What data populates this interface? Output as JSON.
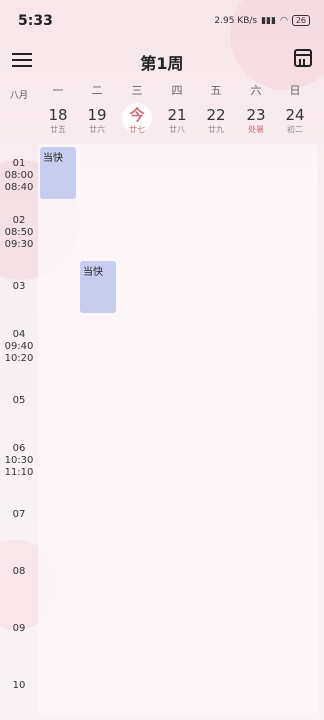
{
  "status": {
    "time": "5:33",
    "net_speed": "2.95 KB/s",
    "battery": "26"
  },
  "header": {
    "title": "第1周"
  },
  "month_label": "八月",
  "weekdays": [
    "一",
    "二",
    "三",
    "四",
    "五",
    "六",
    "日"
  ],
  "dates": [
    {
      "num": "18",
      "lunar": "廿五"
    },
    {
      "num": "19",
      "lunar": "廿六"
    },
    {
      "num": "今",
      "lunar": "廿七"
    },
    {
      "num": "21",
      "lunar": "廿八"
    },
    {
      "num": "22",
      "lunar": "廿九"
    },
    {
      "num": "23",
      "lunar": "处暑"
    },
    {
      "num": "24",
      "lunar": "初二"
    }
  ],
  "periods": [
    {
      "index": "01",
      "start": "08:00",
      "end": "08:40"
    },
    {
      "index": "02",
      "start": "08:50",
      "end": "09:30"
    },
    {
      "index": "03",
      "start": "",
      "end": ""
    },
    {
      "index": "04",
      "start": "09:40",
      "end": "10:20"
    },
    {
      "index": "05",
      "start": "",
      "end": ""
    },
    {
      "index": "06",
      "start": "10:30",
      "end": "11:10"
    },
    {
      "index": "07",
      "start": "",
      "end": ""
    },
    {
      "index": "08",
      "start": "",
      "end": ""
    },
    {
      "index": "09",
      "start": "",
      "end": ""
    },
    {
      "index": "10",
      "start": "",
      "end": ""
    }
  ],
  "events": [
    {
      "title": "当快"
    },
    {
      "title": "当快"
    }
  ],
  "colors": {
    "event_bg": "#c8cdef",
    "accent": "#d36a7a"
  }
}
